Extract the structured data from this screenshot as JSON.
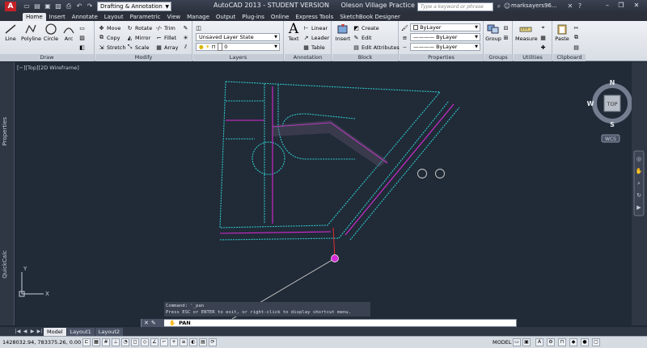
{
  "titlebar": {
    "app_logo": "A",
    "workspace": "Drafting & Annotation",
    "app_title": "AutoCAD 2013 - STUDENT VERSION",
    "document": "Oleson Village Practice Plat 1.d...",
    "search_placeholder": "Type a keyword or phrase",
    "user": "marksayers96..."
  },
  "tabs": [
    "Home",
    "Insert",
    "Annotate",
    "Layout",
    "Parametric",
    "View",
    "Manage",
    "Output",
    "Plug-ins",
    "Online",
    "Express Tools",
    "SketchBook Designer"
  ],
  "ribbon": {
    "draw": {
      "title": "Draw",
      "line": "Line",
      "polyline": "Polyline",
      "circle": "Circle",
      "arc": "Arc"
    },
    "modify": {
      "title": "Modify",
      "move": "Move",
      "rotate": "Rotate",
      "trim": "Trim",
      "copy": "Copy",
      "mirror": "Mirror",
      "fillet": "Fillet",
      "stretch": "Stretch",
      "scale": "Scale",
      "array": "Array"
    },
    "layers": {
      "title": "Layers",
      "state": "Unsaved Layer State",
      "current": "0"
    },
    "annotation": {
      "title": "Annotation",
      "text": "Text",
      "linear": "Linear",
      "leader": "Leader",
      "table": "Table"
    },
    "block": {
      "title": "Block",
      "insert": "Insert",
      "create": "Create",
      "edit": "Edit",
      "edit_attributes": "Edit Attributes"
    },
    "properties": {
      "title": "Properties",
      "color": "ByLayer",
      "linetype": "ByLayer",
      "lineweight": "ByLayer"
    },
    "groups": {
      "title": "Groups",
      "group": "Group"
    },
    "utilities": {
      "title": "Utilities",
      "measure": "Measure"
    },
    "clipboard": {
      "title": "Clipboard",
      "paste": "Paste"
    }
  },
  "palettes": {
    "properties": "Properties",
    "quickcalc": "QuickCalc"
  },
  "viewport": {
    "label": "[−][Top][2D Wireframe]",
    "viewcube": {
      "n": "N",
      "s": "S",
      "e": "E",
      "w": "W",
      "face": "TOP",
      "wcs": "WCS"
    },
    "ucs": {
      "x": "X",
      "y": "Y"
    }
  },
  "command": {
    "history1": "Command: '_pan",
    "history2": "Press ESC or ENTER to exit, or right-click to display shortcut menu.",
    "prompt": "PAN"
  },
  "layout_tabs": [
    "Model",
    "Layout1",
    "Layout2"
  ],
  "status": {
    "coords": "1428032.94, 783375.26, 0.00",
    "model": "MODEL"
  },
  "colors": {
    "cyan": "#2ec9c9",
    "magenta": "#d62bd6",
    "red": "#e03030",
    "white": "#d0d0d0"
  }
}
